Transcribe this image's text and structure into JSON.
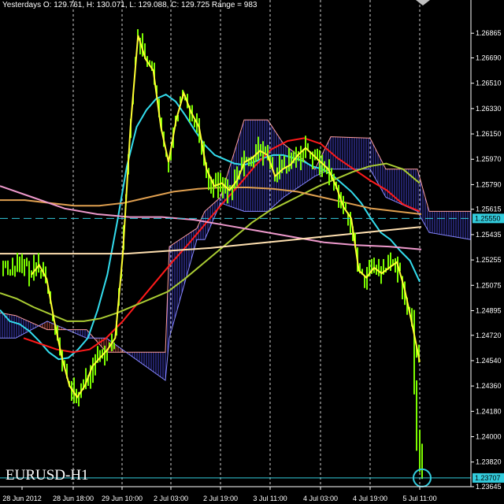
{
  "header": {
    "info_line": "Yesterdays O: 129.761, H: 130.071, L: 129.088, C: 129.725 Range = 983",
    "symbol": "EURUSD-H1"
  },
  "colors": {
    "background": "#000000",
    "candles": "#7cfc00",
    "price_line": "#ffff33",
    "cyan_ma": "#33ddee",
    "red_ma": "#ff1a1a",
    "olive_ma": "#aacc33",
    "orange_ma": "#e0a050",
    "pink_ma": "#ee99cc",
    "beige_ma": "#ffe0b0",
    "kumo_bear": "#cc5544",
    "kumo_bull": "#4444cc",
    "cur_price": "#33ccdd"
  },
  "chart_data": {
    "type": "line",
    "title": "EURUSD-H1",
    "ylim": [
      1.23645,
      1.2695
    ],
    "y_ticks": [
      "1.26865",
      "1.26690",
      "1.26510",
      "1.26330",
      "1.26150",
      "1.25970",
      "1.25790",
      "1.25615",
      "1.25435",
      "1.25255",
      "1.25075",
      "1.24895",
      "1.24720",
      "1.24540",
      "1.24360",
      "1.24180",
      "1.24000",
      "1.23820",
      "1.23645"
    ],
    "x_ticks": [
      "28 Jun 2012",
      "28 Jun 18:00",
      "29 Jun 10:00",
      "2 Jul 03:00",
      "2 Jul 19:00",
      "3 Jul 11:00",
      "4 Jul 03:00",
      "4 Jul 19:00",
      "5 Jul 11:00"
    ],
    "current_price": "1.23707",
    "level_price": "1.25550",
    "series": [
      {
        "key": "price",
        "values": [
          1.2515,
          1.2522,
          1.2512,
          1.2482,
          1.2456,
          1.2436,
          1.2428,
          1.2436,
          1.245,
          1.2456,
          1.2462,
          1.247,
          1.253,
          1.262,
          1.2685,
          1.2668,
          1.266,
          1.262,
          1.2595,
          1.2625,
          1.2644,
          1.263,
          1.262,
          1.259,
          1.2578,
          1.258,
          1.2575,
          1.2582,
          1.2595,
          1.2598,
          1.2603,
          1.26,
          1.2585,
          1.259,
          1.2593,
          1.26,
          1.2605,
          1.26,
          1.2595,
          1.259,
          1.2578,
          1.2563,
          1.2555,
          1.2518,
          1.2513,
          1.252,
          1.2516,
          1.252,
          1.2524,
          1.2505,
          1.248,
          1.2453
        ]
      },
      {
        "key": "cyan",
        "values": [
          1.249,
          1.2482,
          1.248,
          1.2475,
          1.2468,
          1.246,
          1.2455,
          1.2456,
          1.2462,
          1.247,
          1.249,
          1.2515,
          1.2552,
          1.2592,
          1.262,
          1.2632,
          1.264,
          1.2643,
          1.2638,
          1.2628,
          1.2617,
          1.2607,
          1.26,
          1.2597,
          1.2594,
          1.2593,
          1.2595,
          1.2598,
          1.26,
          1.26,
          1.2598,
          1.2596,
          1.2592,
          1.259,
          1.2586,
          1.258,
          1.2574,
          1.2566,
          1.2555,
          1.2545,
          1.254,
          1.2532,
          1.2525,
          1.251
        ]
      },
      {
        "key": "red",
        "values": [
          1.247,
          1.2466,
          1.2462,
          1.246,
          1.2462,
          1.247,
          1.2482,
          1.2496,
          1.251,
          1.2524,
          1.2537,
          1.2551,
          1.2565,
          1.2578,
          1.2592,
          1.2604,
          1.261,
          1.2612,
          1.2608,
          1.2598,
          1.259,
          1.2582,
          1.2575,
          1.2565,
          1.256
        ]
      },
      {
        "key": "olive",
        "values": [
          1.2502,
          1.2498,
          1.2492,
          1.2487,
          1.2482,
          1.2482,
          1.2484,
          1.2488,
          1.2493,
          1.2498,
          1.2503,
          1.2512,
          1.2522,
          1.2532,
          1.2542,
          1.2552,
          1.256,
          1.2566,
          1.2572,
          1.2578,
          1.2583,
          1.2588,
          1.2592,
          1.2594,
          1.259,
          1.258
        ]
      },
      {
        "key": "orange",
        "values": [
          1.2568,
          1.2568,
          1.2566,
          1.2564,
          1.2564,
          1.2566,
          1.257,
          1.2574,
          1.2576,
          1.2577,
          1.2577,
          1.2576,
          1.2574,
          1.257,
          1.2566,
          1.2562,
          1.256,
          1.2558
        ]
      },
      {
        "key": "pink",
        "values": [
          1.2578,
          1.257,
          1.2562,
          1.2558,
          1.2556,
          1.2556,
          1.2554,
          1.255,
          1.2546,
          1.2542,
          1.2538,
          1.2536,
          1.2535,
          1.2533
        ]
      },
      {
        "key": "beige",
        "values": [
          1.253,
          1.253,
          1.253,
          1.253,
          1.2532,
          1.2534,
          1.2537,
          1.254,
          1.2543,
          1.2546,
          1.2549
        ]
      }
    ]
  }
}
